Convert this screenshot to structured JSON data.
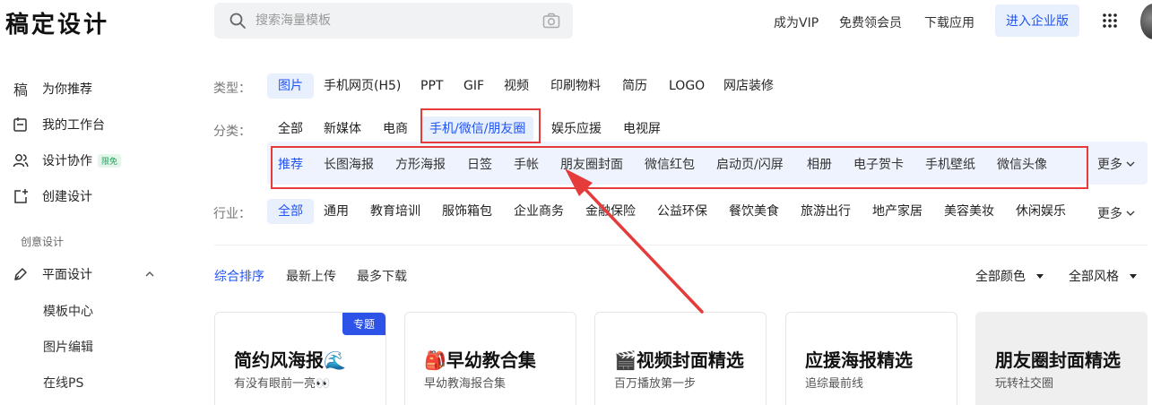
{
  "header": {
    "logo": "稿定设计",
    "search_placeholder": "搜索海量模板",
    "links": [
      "成为VIP",
      "免费领会员",
      "下载应用"
    ],
    "enterprise_button": "进入企业版"
  },
  "sidebar": {
    "items": [
      {
        "label": "为你推荐",
        "icon": "gao-logo-icon",
        "glyph": "稿"
      },
      {
        "label": "我的工作台",
        "icon": "workspace-icon",
        "glyph": "▢"
      },
      {
        "label": "设计协作",
        "icon": "users-icon",
        "glyph": "",
        "badge": "限免"
      },
      {
        "label": "创建设计",
        "icon": "create-icon",
        "glyph": ""
      }
    ],
    "section_title": "创意设计",
    "group": {
      "label": "平面设计",
      "icon": "pen-icon"
    },
    "sub_items": [
      "模板中心",
      "图片编辑",
      "在线PS"
    ]
  },
  "filters": {
    "type_label": "类型：",
    "types": [
      "图片",
      "手机网页(H5)",
      "PPT",
      "GIF",
      "视频",
      "印刷物料",
      "简历",
      "LOGO",
      "网店装修"
    ],
    "type_active": 0,
    "category_label": "分类：",
    "categories": [
      "全部",
      "新媒体",
      "电商",
      "手机/微信/朋友圈",
      "娱乐应援",
      "电视屏"
    ],
    "category_active": 3,
    "subcategories": [
      "推荐",
      "长图海报",
      "方形海报",
      "日签",
      "手帐",
      "朋友圈封面",
      "微信红包",
      "启动页/闪屏",
      "相册",
      "电子贺卡",
      "手机壁纸",
      "微信头像"
    ],
    "subcategory_active": 0,
    "more_label": "更多",
    "industry_label": "行业：",
    "industries": [
      "全部",
      "通用",
      "教育培训",
      "服饰箱包",
      "企业商务",
      "金融保险",
      "公益环保",
      "餐饮美食",
      "旅游出行",
      "地产家居",
      "美容美妆",
      "休闲娱乐"
    ],
    "industry_active": 0
  },
  "sort": {
    "options": [
      "综合排序",
      "最新上传",
      "最多下载"
    ],
    "active": 0,
    "color_filter": "全部颜色",
    "style_filter": "全部风格"
  },
  "cards": [
    {
      "title": "简约风海报🌊",
      "subtitle": "有没有眼前一亮👀",
      "tag": "专题"
    },
    {
      "title": "🎒早幼教合集",
      "subtitle": "早幼教海报合集",
      "tag": ""
    },
    {
      "title": "🎬视频封面精选",
      "subtitle": "百万播放第一步",
      "tag": ""
    },
    {
      "title": "应援海报精选",
      "subtitle": "追综最前线",
      "tag": ""
    },
    {
      "title": "朋友圈封面精选",
      "subtitle": "玩转社交圈",
      "tag": ""
    }
  ],
  "colors": {
    "accent": "#2254f4",
    "annotation": "#e53b3b",
    "active_bg": "#e8f0fe"
  }
}
